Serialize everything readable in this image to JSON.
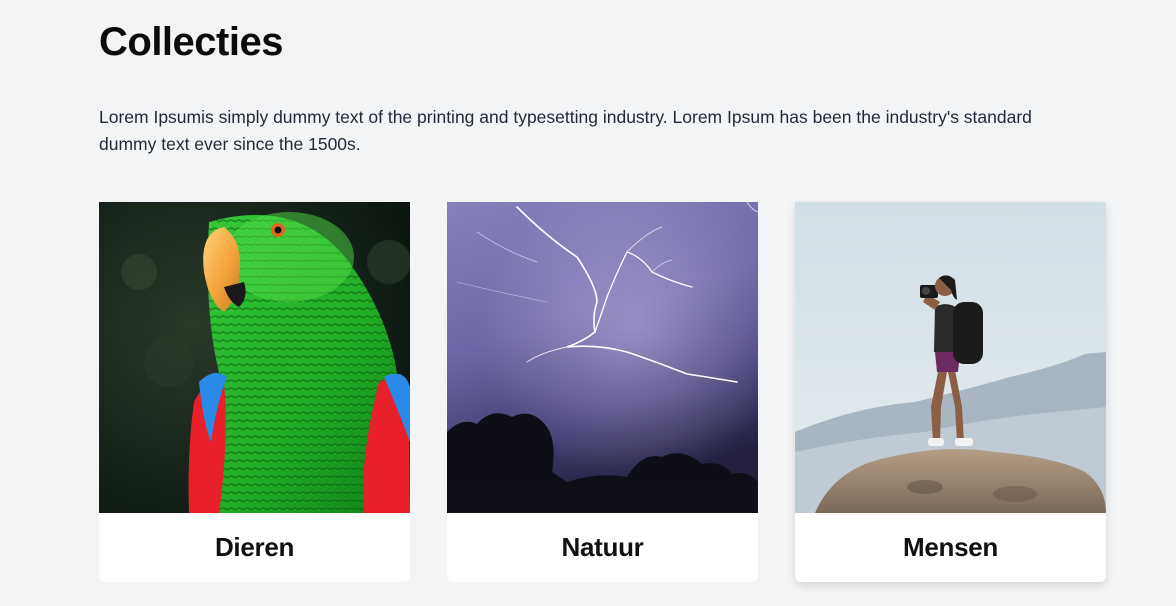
{
  "header": {
    "title": "Collecties",
    "intro": "Lorem Ipsumis simply dummy text of the printing and typesetting industry. Lorem Ipsum has been the industry's standard dummy text ever since the 1500s."
  },
  "collections": [
    {
      "label": "Dieren",
      "image": "parrot-photo"
    },
    {
      "label": "Natuur",
      "image": "lightning-photo"
    },
    {
      "label": "Mensen",
      "image": "photographer-on-rock-photo"
    }
  ],
  "colors": {
    "background": "#f3f4f6",
    "card": "#ffffff",
    "text": "#111111"
  }
}
